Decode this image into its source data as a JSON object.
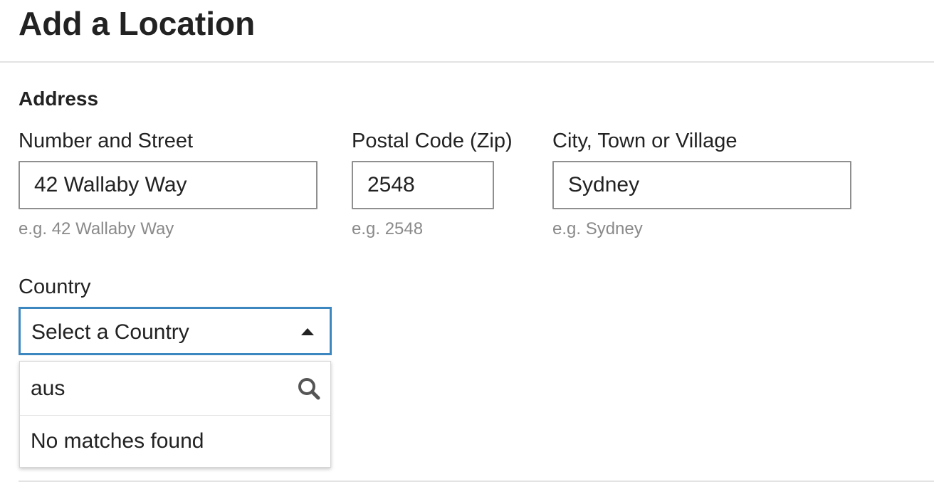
{
  "page": {
    "title": "Add a Location"
  },
  "address": {
    "heading": "Address",
    "street": {
      "label": "Number and Street",
      "value": "42 Wallaby Way",
      "hint": "e.g. 42 Wallaby Way"
    },
    "postal": {
      "label": "Postal Code (Zip)",
      "value": "2548",
      "hint": "e.g. 2548"
    },
    "city": {
      "label": "City, Town or Village",
      "value": "Sydney",
      "hint": "e.g. Sydney"
    }
  },
  "country": {
    "label": "Country",
    "selected": "Select a Country",
    "search_value": "aus",
    "no_results": "No matches found",
    "icons": {
      "caret": "caret-up-icon",
      "search": "search-icon"
    }
  },
  "colors": {
    "focus_border": "#3d87c0",
    "input_border": "#8f8f8f",
    "hint_text": "#8a8a8a"
  }
}
